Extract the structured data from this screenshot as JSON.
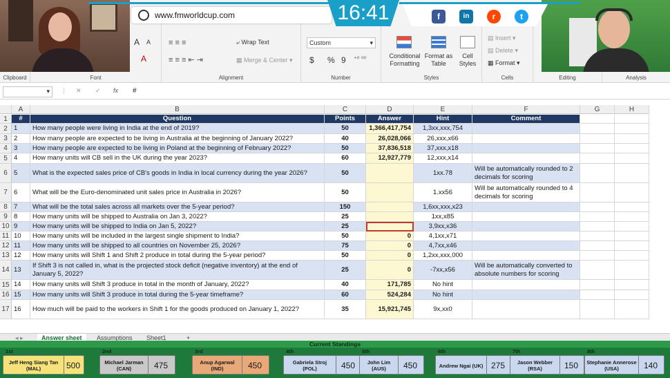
{
  "ribbon": {
    "font_a_large": "A",
    "font_a_small": "A",
    "wrap_text": "Wrap Text",
    "merge_center": "Merge & Center",
    "number_format": "Custom",
    "currency": "$",
    "percent": "%",
    "comma": "9",
    "conditional_formatting": "Conditional Formatting",
    "format_as_table": "Format as Table",
    "cell_styles": "Cell Styles",
    "insert": "Insert",
    "delete": "Delete",
    "format": "Format",
    "groups": {
      "clipboard": "Clipboard",
      "font": "Font",
      "alignment": "Alignment",
      "number": "Number",
      "styles": "Styles",
      "cells": "Cells",
      "editing": "Editing",
      "analysis": "Analysis"
    }
  },
  "overlay": {
    "url": "www.fmworldcup.com",
    "clock": "16:41",
    "social": [
      "f",
      "in",
      "r",
      "t"
    ]
  },
  "formula_bar": {
    "name_box": "",
    "fx": "fx",
    "content": "#"
  },
  "columns": [
    "A",
    "B",
    "C",
    "D",
    "E",
    "F",
    "G",
    "H"
  ],
  "sheet": {
    "headers": {
      "num": "#",
      "question": "Question",
      "points": "Points",
      "answer": "Answer",
      "hint": "Hint",
      "comment": "Comment"
    },
    "rows": [
      {
        "row": "2",
        "num": "1",
        "q": "How many people were living in India at the end of 2019?",
        "pts": "50",
        "ans": "1,366,417,754",
        "hint": "1,3xx,xxx,754",
        "comment": ""
      },
      {
        "row": "3",
        "num": "2",
        "q": "How many people are expected to be living in Australia at the beginning of January 2022?",
        "pts": "40",
        "ans": "26,028,066",
        "hint": "26,xxx,x66",
        "comment": ""
      },
      {
        "row": "4",
        "num": "3",
        "q": "How many people are expected to be living in Poland at the beginning of February 2022?",
        "pts": "50",
        "ans": "37,836,518",
        "hint": "37,xxx,x18",
        "comment": ""
      },
      {
        "row": "5",
        "num": "4",
        "q": "How many units will CB sell in the UK during the year 2023?",
        "pts": "60",
        "ans": "12,927,779",
        "hint": "12,xxx,x14",
        "comment": ""
      },
      {
        "row": "6",
        "num": "5",
        "q": "What is the expected sales price of CB's goods in India in local currency during the year 2026?",
        "pts": "50",
        "ans": "",
        "hint": "1xx.78",
        "comment": "Will be automatically rounded to 2 decimals for scoring"
      },
      {
        "row": "7",
        "num": "6",
        "q": "What will be the Euro-denominated unit sales price in Australia in 2026?",
        "pts": "50",
        "ans": "",
        "hint": "1.xx56",
        "comment": "Will be automatically rounded to 4 decimals for scoring"
      },
      {
        "row": "8",
        "num": "7",
        "q": "What will be the total sales across all markets over the 5-year period?",
        "pts": "150",
        "ans": "",
        "hint": "1,6xx,xxx,x23",
        "comment": ""
      },
      {
        "row": "9",
        "num": "8",
        "q": "How many units will be shipped to Australia on Jan 3, 2022?",
        "pts": "25",
        "ans": "",
        "hint": "1xx,x85",
        "comment": ""
      },
      {
        "row": "10",
        "num": "9",
        "q": "How many units will be shipped to India on Jan 5, 2022?",
        "pts": "25",
        "ans": "",
        "hint": "3,9xx,x36",
        "comment": ""
      },
      {
        "row": "11",
        "num": "10",
        "q": "How many units will be included in the largest single shipment to India?",
        "pts": "50",
        "ans": "0",
        "hint": "4,1xx,x71",
        "comment": ""
      },
      {
        "row": "12",
        "num": "11",
        "q": "How many units will be shipped to all countries on November 25, 2026?",
        "pts": "75",
        "ans": "0",
        "hint": "4,7xx,x46",
        "comment": ""
      },
      {
        "row": "13",
        "num": "12",
        "q": "How many units will Shift 1 and Shift 2 produce in total during the 5-year period?",
        "pts": "50",
        "ans": "0",
        "hint": "1,2xx,xxx,000",
        "comment": ""
      },
      {
        "row": "14",
        "num": "13",
        "q": "If Shift 3 is not called in, what is the projected stock deficit (negative inventory) at the end of January 5, 2022?",
        "pts": "25",
        "ans": "0",
        "hint": "-7xx,x56",
        "comment": "Will be automatically converted to absolute numbers for scoring"
      },
      {
        "row": "15",
        "num": "14",
        "q": "How many units will Shift 3 produce in total in the month of January, 2022?",
        "pts": "40",
        "ans": "171,785",
        "hint": "No hint",
        "comment": ""
      },
      {
        "row": "16",
        "num": "15",
        "q": "How many units will Shift 3 produce in total during the 5-year timeframe?",
        "pts": "60",
        "ans": "524,284",
        "hint": "No hint",
        "comment": ""
      },
      {
        "row": "17",
        "num": "16",
        "q": "How much will be paid to the workers in Shift 1 for the goods produced on January 1, 2022?",
        "pts": "35",
        "ans": "15,921,745",
        "hint": "9x,xx0",
        "comment": ""
      }
    ]
  },
  "tabs": [
    "Answer sheet",
    "Assumptions",
    "Sheet1",
    "+"
  ],
  "standings": {
    "title": "Current Standings",
    "players": [
      {
        "place": "1st",
        "name": "Jeff Heng Siang Tan (MAL)",
        "score": "500",
        "color": "#f6e27a"
      },
      {
        "place": "2nd",
        "name": "Michael Jarman (CAN)",
        "score": "475",
        "color": "#c9c9c9"
      },
      {
        "place": "3rd",
        "name": "Anup Agarwal (IND)",
        "score": "450",
        "color": "#e9a878"
      },
      {
        "place": "4th",
        "name": "Gabriela Stroj (POL)",
        "score": "450",
        "color": "#c9d8ee"
      },
      {
        "place": "5th",
        "name": "John Lim (AUS)",
        "score": "450",
        "color": "#c9d8ee"
      },
      {
        "place": "6th",
        "name": "Andrew Ngai (UK)",
        "score": "275",
        "color": "#c9d8ee"
      },
      {
        "place": "7th",
        "name": "Jason Webber (RSA)",
        "score": "150",
        "color": "#c9d8ee"
      },
      {
        "place": "8th",
        "name": "Stephanie Annerose (USA)",
        "score": "140",
        "color": "#c9d8ee"
      }
    ]
  },
  "colors": {
    "header_navy": "#1f3864",
    "row_band": "#d9e2f3",
    "answer_yellow": "#fdf8d2",
    "overlay_teal": "#1aa0c8",
    "standings_green": "#1e7a3a"
  }
}
